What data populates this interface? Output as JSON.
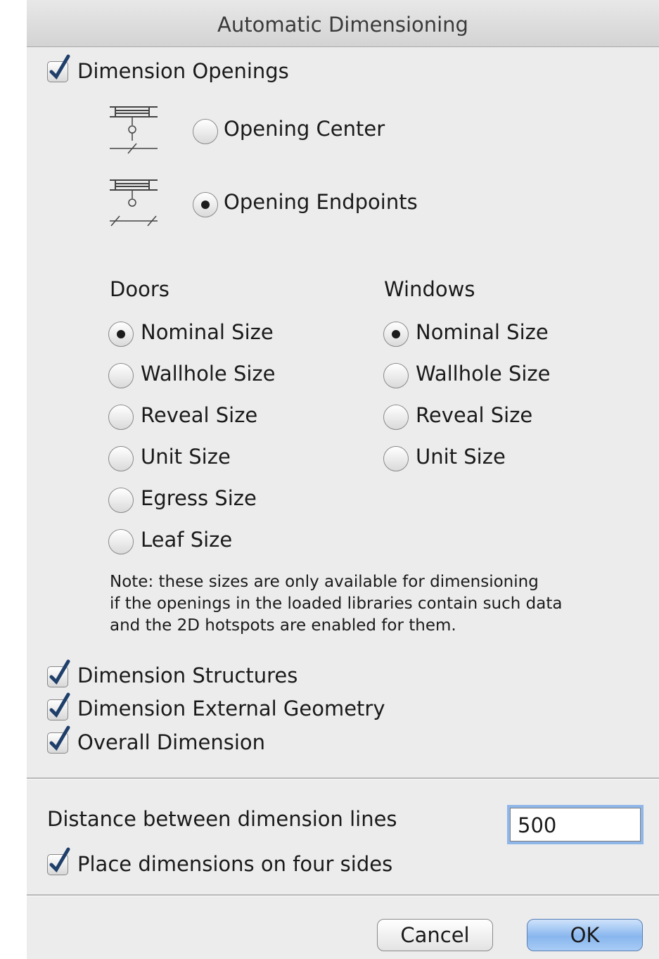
{
  "dialog": {
    "title": "Automatic Dimensioning"
  },
  "openings": {
    "label": "Dimension Openings",
    "checked": true,
    "modes": [
      {
        "label": "Opening Center",
        "selected": false,
        "icon": "opening-center-dimension-icon"
      },
      {
        "label": "Opening Endpoints",
        "selected": true,
        "icon": "opening-endpoints-dimension-icon"
      }
    ]
  },
  "doors": {
    "title": "Doors",
    "options": [
      {
        "label": "Nominal Size",
        "selected": true
      },
      {
        "label": "Wallhole Size",
        "selected": false
      },
      {
        "label": "Reveal Size",
        "selected": false
      },
      {
        "label": "Unit Size",
        "selected": false
      },
      {
        "label": "Egress Size",
        "selected": false
      },
      {
        "label": "Leaf Size",
        "selected": false
      }
    ]
  },
  "windows": {
    "title": "Windows",
    "options": [
      {
        "label": "Nominal Size",
        "selected": true
      },
      {
        "label": "Wallhole Size",
        "selected": false
      },
      {
        "label": "Reveal Size",
        "selected": false
      },
      {
        "label": "Unit Size",
        "selected": false
      }
    ]
  },
  "note": {
    "lines": [
      "Note: these sizes are only available for dimensioning",
      "if the openings in the loaded libraries contain such data",
      "and the 2D hotspots are enabled for them."
    ]
  },
  "checks": [
    {
      "label": "Dimension Structures",
      "checked": true
    },
    {
      "label": "Dimension External Geometry",
      "checked": true
    },
    {
      "label": "Overall Dimension",
      "checked": true
    }
  ],
  "distance": {
    "label": "Distance between dimension lines",
    "value": "500"
  },
  "four_sides": {
    "label": "Place dimensions on four sides",
    "checked": true
  },
  "buttons": {
    "cancel": "Cancel",
    "ok": "OK"
  },
  "colors": {
    "accent": "#88b6ee",
    "checkmark": "#1f3f6b"
  }
}
